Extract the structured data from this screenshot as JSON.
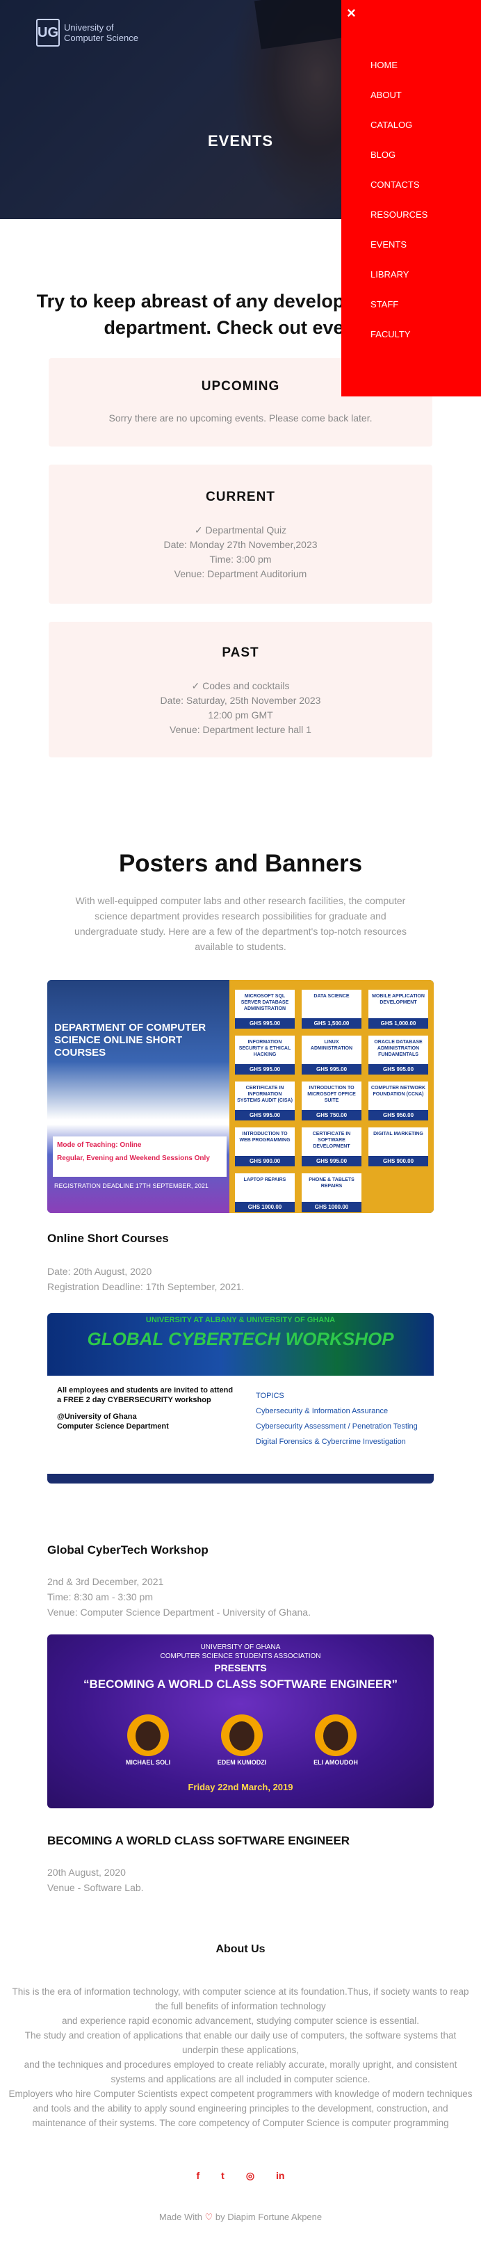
{
  "hero": {
    "logo_line1": "University of",
    "logo_line2": "Computer Science",
    "title": "EVENTS"
  },
  "menu": {
    "close_icon": "×",
    "items": [
      "HOME",
      "ABOUT",
      "CATALOG",
      "BLOG",
      "CONTACTS",
      "RESOURCES",
      "EVENTS",
      "LIBRARY",
      "STAFF",
      "FACULTY"
    ]
  },
  "headline": "Try to keep abreast of any development in the department. Check out events.",
  "events": {
    "upcoming": {
      "title": "UPCOMING",
      "message": "Sorry there are no upcoming events. Please come back later."
    },
    "current": {
      "title": "CURRENT",
      "name": "✓ Departmental Quiz",
      "date": "Date: Monday 27th November,2023",
      "time": "Time: 3:00 pm",
      "venue": "Venue: Department Auditorium"
    },
    "past": {
      "title": "PAST",
      "name": "✓ Codes and cocktails",
      "date": "Date: Saturday, 25th November 2023",
      "time": "12:00 pm GMT",
      "venue": "Venue: Department lecture hall 1"
    }
  },
  "posters": {
    "title": "Posters and Banners",
    "description": "With well-equipped computer labs and other research facilities, the computer science department provides research possibilities for graduate and undergraduate study. Here are a few of the department's top-notch resources available to students.",
    "items": [
      {
        "title": "Online Short Courses",
        "meta1": "Date: 20th August, 2020",
        "meta2": "Registration Deadline: 17th September, 2021.",
        "image_heading": "DEPARTMENT OF COMPUTER SCIENCE ONLINE SHORT COURSES",
        "image_box1": "Mode of Teaching: Online",
        "image_box2": "Regular, Evening and Weekend Sessions Only",
        "image_foot": "REGISTRATION DEADLINE 17TH SEPTEMBER, 2021",
        "tiles": [
          {
            "name": "MICROSOFT SQL SERVER DATABASE ADMINISTRATION",
            "price": "GHS 995.00"
          },
          {
            "name": "DATA SCIENCE",
            "price": "GHS 1,500.00"
          },
          {
            "name": "MOBILE APPLICATION DEVELOPMENT",
            "price": "GHS 1,000.00"
          },
          {
            "name": "INFORMATION SECURITY & ETHICAL HACKING",
            "price": "GHS 995.00"
          },
          {
            "name": "LINUX ADMINISTRATION",
            "price": "GHS 995.00"
          },
          {
            "name": "ORACLE DATABASE ADMINISTRATION FUNDAMENTALS",
            "price": "GHS 995.00"
          },
          {
            "name": "CERTIFICATE IN INFORMATION SYSTEMS AUDIT (CISA)",
            "price": "GHS 995.00"
          },
          {
            "name": "INTRODUCTION TO MICROSOFT OFFICE SUITE",
            "price": "GHS 750.00"
          },
          {
            "name": "COMPUTER NETWORK FOUNDATION (CCNA)",
            "price": "GHS 950.00"
          },
          {
            "name": "INTRODUCTION TO WEB PROGRAMMING",
            "price": "GHS 900.00"
          },
          {
            "name": "CERTIFICATE IN SOFTWARE DEVELOPMENT",
            "price": "GHS 995.00"
          },
          {
            "name": "DIGITAL MARKETING",
            "price": "GHS 900.00"
          },
          {
            "name": "LAPTOP REPAIRS",
            "price": "GHS 1000.00"
          },
          {
            "name": "PHONE & TABLETS REPAIRS",
            "price": "GHS 1000.00"
          }
        ]
      },
      {
        "title": "Global CyberTech Workshop",
        "meta1": "2nd & 3rd December, 2021",
        "meta2": "Time: 8:30 am - 3:30 pm",
        "meta3": "Venue: Computer Science Department - University of Ghana.",
        "image_top1": "UNIVERSITY AT ALBANY & UNIVERSITY OF GHANA",
        "image_top2": "GLOBAL CYBERTECH WORKSHOP",
        "image_left": "All employees and students are invited to attend a FREE 2 day CYBERSECURITY workshop",
        "image_left2": "@University of Ghana",
        "image_left3": "Computer Science Department",
        "image_right1": "TOPICS",
        "image_right2": "Cybersecurity & Information Assurance",
        "image_right3": "Cybersecurity Assessment / Penetration Testing",
        "image_right4": "Digital Forensics & Cybercrime Investigation"
      },
      {
        "title": "BECOMING A WORLD CLASS SOFTWARE ENGINEER",
        "meta1": "20th August, 2020",
        "meta2": "Venue - Software Lab.",
        "image_h1": "UNIVERSITY OF GHANA",
        "image_h1b": "COMPUTER SCIENCE STUDENTS ASSOCIATION",
        "image_h2": "PRESENTS",
        "image_h3": "“BECOMING A WORLD CLASS SOFTWARE ENGINEER”",
        "speakers": [
          "MICHAEL SOLI",
          "EDEM KUMODZI",
          "ELI AMOUDOH"
        ],
        "image_date": "Friday 22nd March, 2019"
      }
    ]
  },
  "about": {
    "title": "About Us",
    "lines": [
      "This is the era of information technology, with computer science at its foundation.Thus, if society wants to reap the full benefits of information technology",
      "and experience rapid economic advancement, studying computer science is essential.",
      "The study and creation of applications that enable our daily use of computers, the software systems that underpin these applications,",
      "and the techniques and procedures employed to create reliably accurate, morally upright, and consistent systems and applications are all included in computer science.",
      "Employers who hire Computer Scientists expect competent programmers with knowledge of modern techniques and tools and the ability to apply sound engineering principles to the development, construction, and maintenance of their systems. The core competency of Computer Science is computer programming"
    ]
  },
  "social": {
    "icons": [
      "f",
      "t",
      "◎",
      "in"
    ]
  },
  "credit": {
    "prefix": "Made With",
    "heart": "♡",
    "suffix": "by Diapim Fortune Akpene"
  },
  "colors": {
    "menu_bg": "#ff0000",
    "card_bg": "#fdf2f0",
    "accent": "#e02020"
  }
}
